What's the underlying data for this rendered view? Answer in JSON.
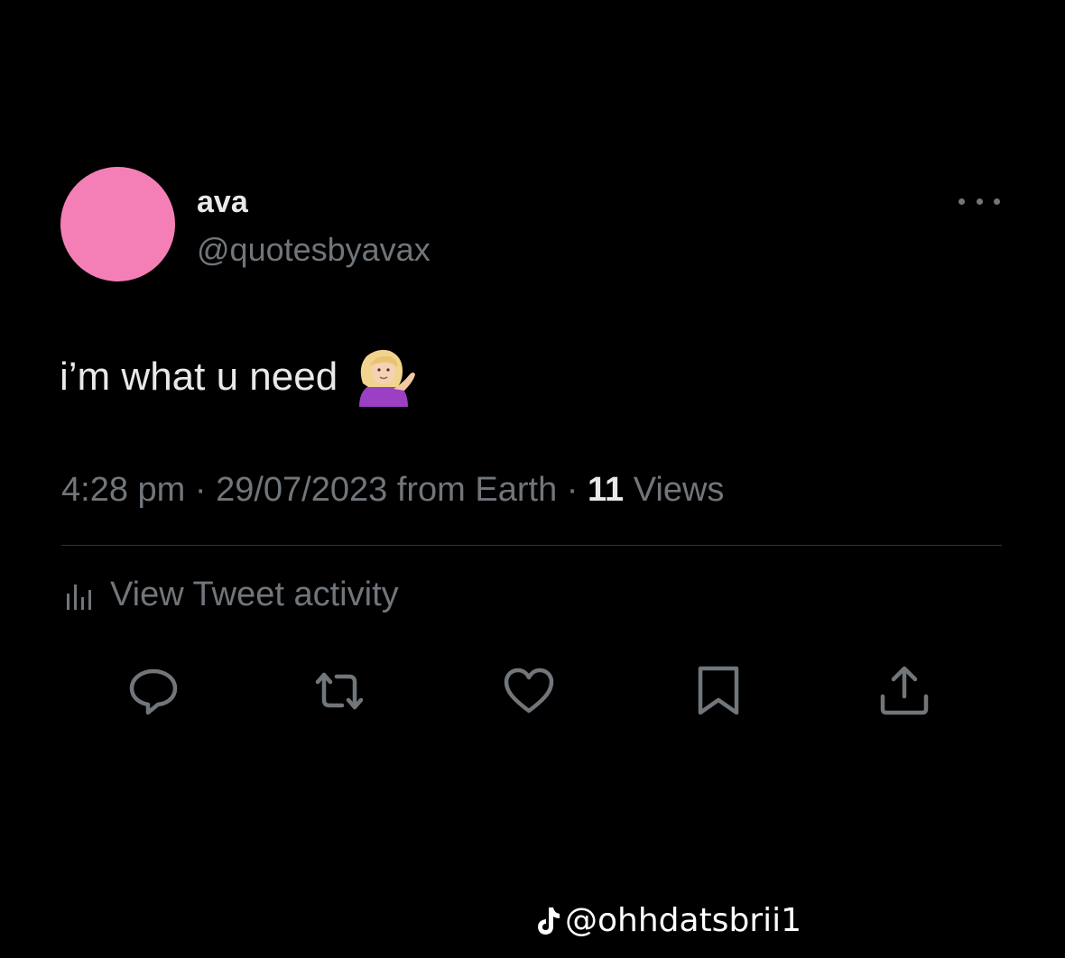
{
  "tweet": {
    "author": {
      "display_name": "ava",
      "handle": "@quotesbyavax",
      "avatar_color": "#f47fb6"
    },
    "text": "i’m what u need",
    "emoji": "woman-tipping-hand",
    "meta": {
      "time": "4:28 pm",
      "separator": "·",
      "date_source": "29/07/2023 from Earth",
      "views_count": "11",
      "views_label": "Views"
    },
    "activity_label": "View Tweet activity",
    "actions": [
      "reply-icon",
      "retweet-icon",
      "like-icon",
      "bookmark-icon",
      "share-icon"
    ]
  },
  "watermark": {
    "platform_icon": "tiktok-icon",
    "username": "@ohhdatsbrii1"
  },
  "colors": {
    "background": "#000000",
    "primary_text": "#e7e9ea",
    "secondary_text": "#71767b",
    "divider": "#2f3336"
  }
}
